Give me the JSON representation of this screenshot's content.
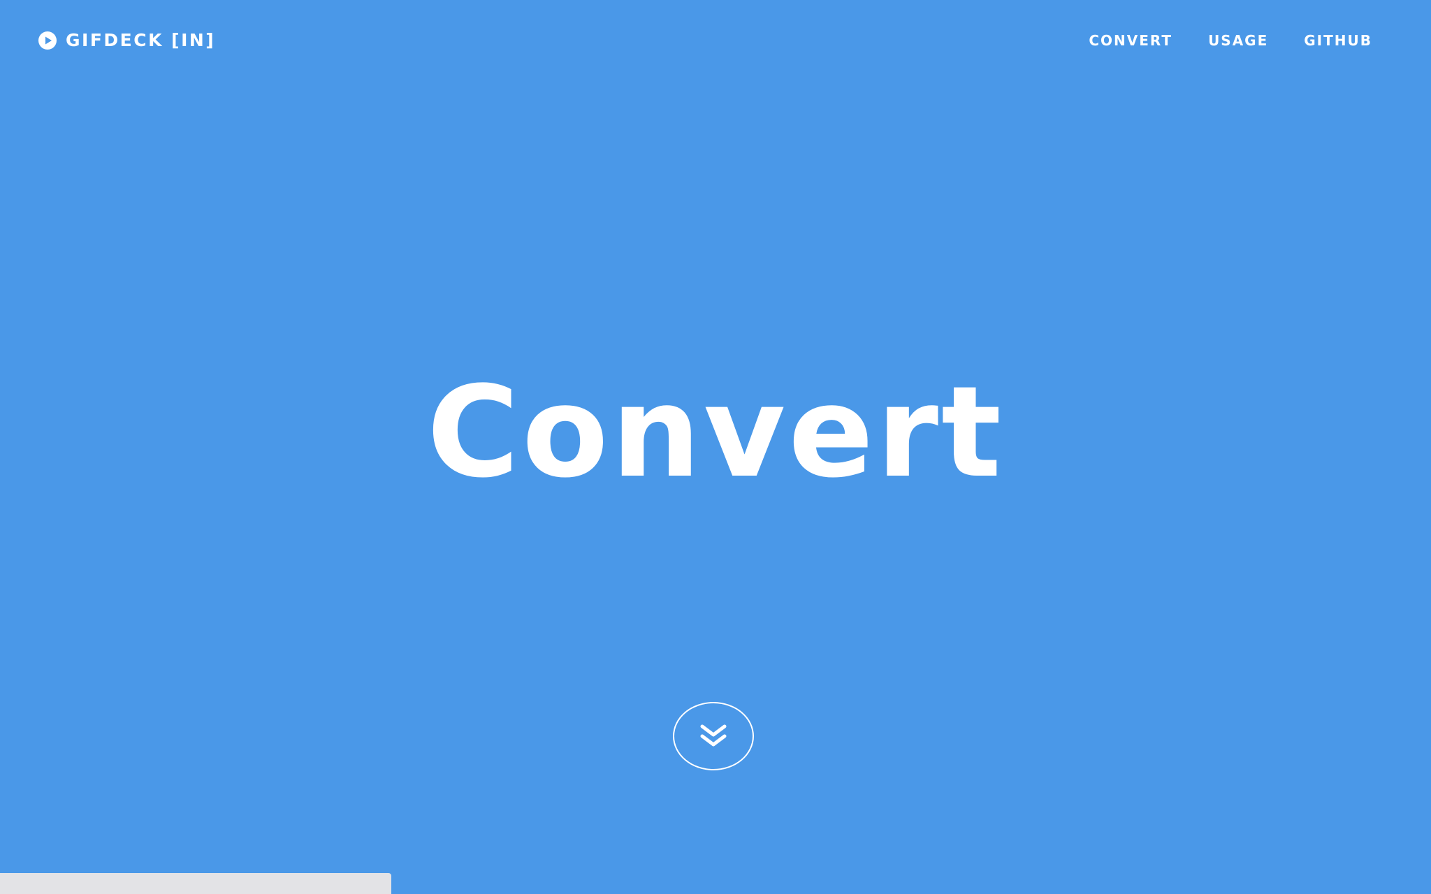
{
  "brand": {
    "name": "GIFDECK [IN]",
    "icon": "play-circle-icon"
  },
  "nav": {
    "items": [
      {
        "label": "CONVERT"
      },
      {
        "label": "USAGE"
      },
      {
        "label": "GITHUB"
      }
    ]
  },
  "hero": {
    "title": "Convert",
    "scroll_icon": "double-chevron-down-icon"
  },
  "colors": {
    "background": "#4a98e8",
    "text": "#ffffff",
    "bottom_bar": "#e3e3e6"
  }
}
